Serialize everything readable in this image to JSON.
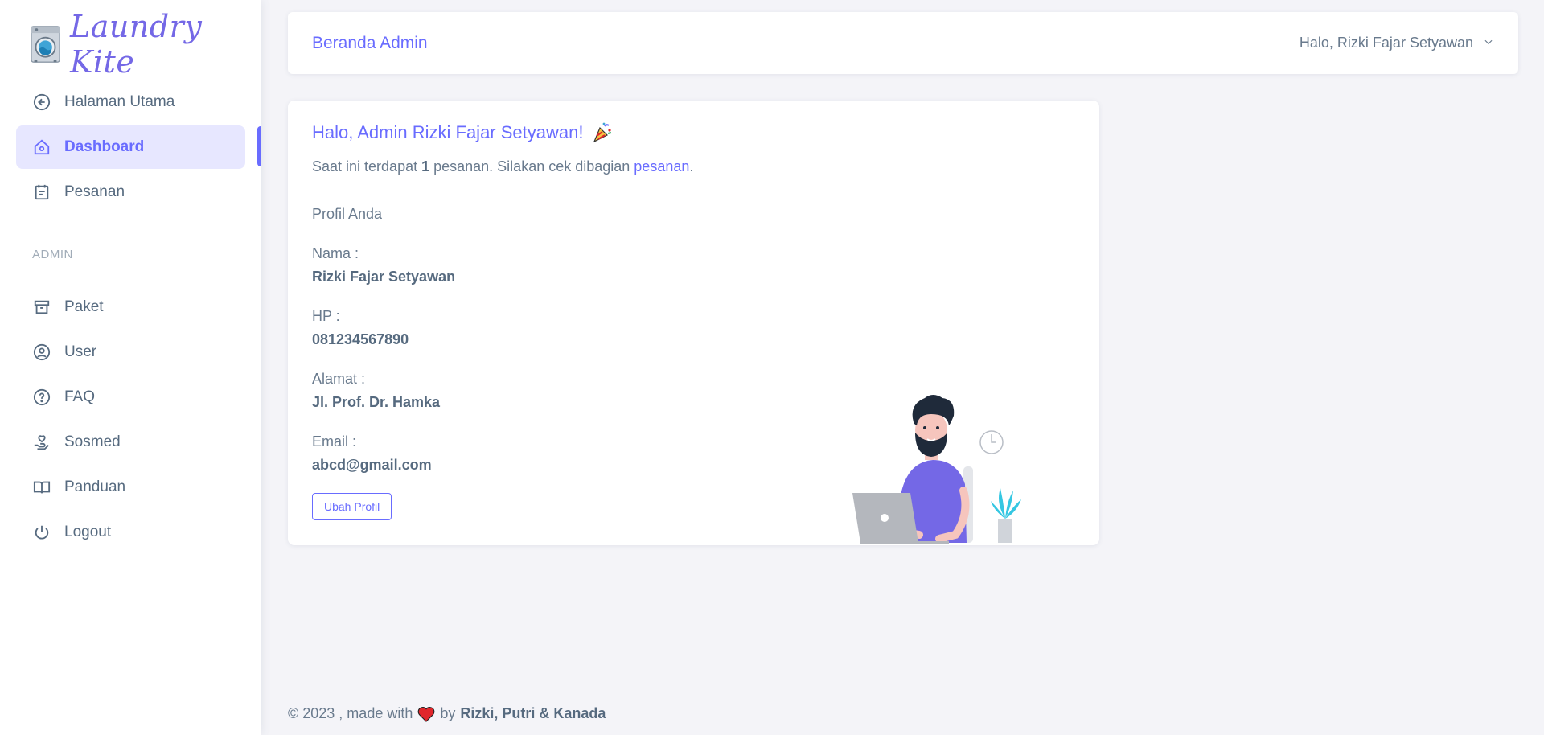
{
  "brand": {
    "name": "Laundry Kite",
    "logo_icon": "washing-machine-icon"
  },
  "sidebar": {
    "items_top": [
      {
        "label": "Halaman Utama",
        "icon": "arrow-left-circle-icon"
      },
      {
        "label": "Dashboard",
        "icon": "home-icon",
        "active": true
      },
      {
        "label": "Pesanan",
        "icon": "calendar-icon"
      }
    ],
    "section_header": "ADMIN",
    "items_admin": [
      {
        "label": "Paket",
        "icon": "archive-icon"
      },
      {
        "label": "User",
        "icon": "user-circle-icon"
      },
      {
        "label": "FAQ",
        "icon": "question-circle-icon"
      },
      {
        "label": "Sosmed",
        "icon": "hand-heart-icon"
      },
      {
        "label": "Panduan",
        "icon": "book-icon"
      },
      {
        "label": "Logout",
        "icon": "power-icon"
      }
    ]
  },
  "navbar": {
    "title": "Beranda Admin",
    "user_greeting": "Halo, Rizki Fajar Setyawan"
  },
  "card": {
    "greeting": "Halo, Admin Rizki Fajar Setyawan!",
    "notice_prefix": "Saat ini terdapat ",
    "notice_count": "1",
    "notice_middle": " pesanan. Silakan cek dibagian ",
    "notice_link": "pesanan",
    "notice_suffix": ".",
    "profile_title": "Profil Anda",
    "fields": [
      {
        "label": "Nama :",
        "value": "Rizki Fajar Setyawan"
      },
      {
        "label": "HP :",
        "value": "081234567890"
      },
      {
        "label": "Alamat :",
        "value": "Jl. Prof. Dr. Hamka"
      },
      {
        "label": "Email :",
        "value": "abcd@gmail.com"
      }
    ],
    "edit_button": "Ubah Profil"
  },
  "footer": {
    "prefix": "© 2023 , made with",
    "by": "by",
    "authors": "Rizki, Putri & Kanada"
  },
  "colors": {
    "accent": "#696cff",
    "active_bg": "#e7e7ff",
    "text": "#697a8d",
    "heart": "#e0262b"
  }
}
